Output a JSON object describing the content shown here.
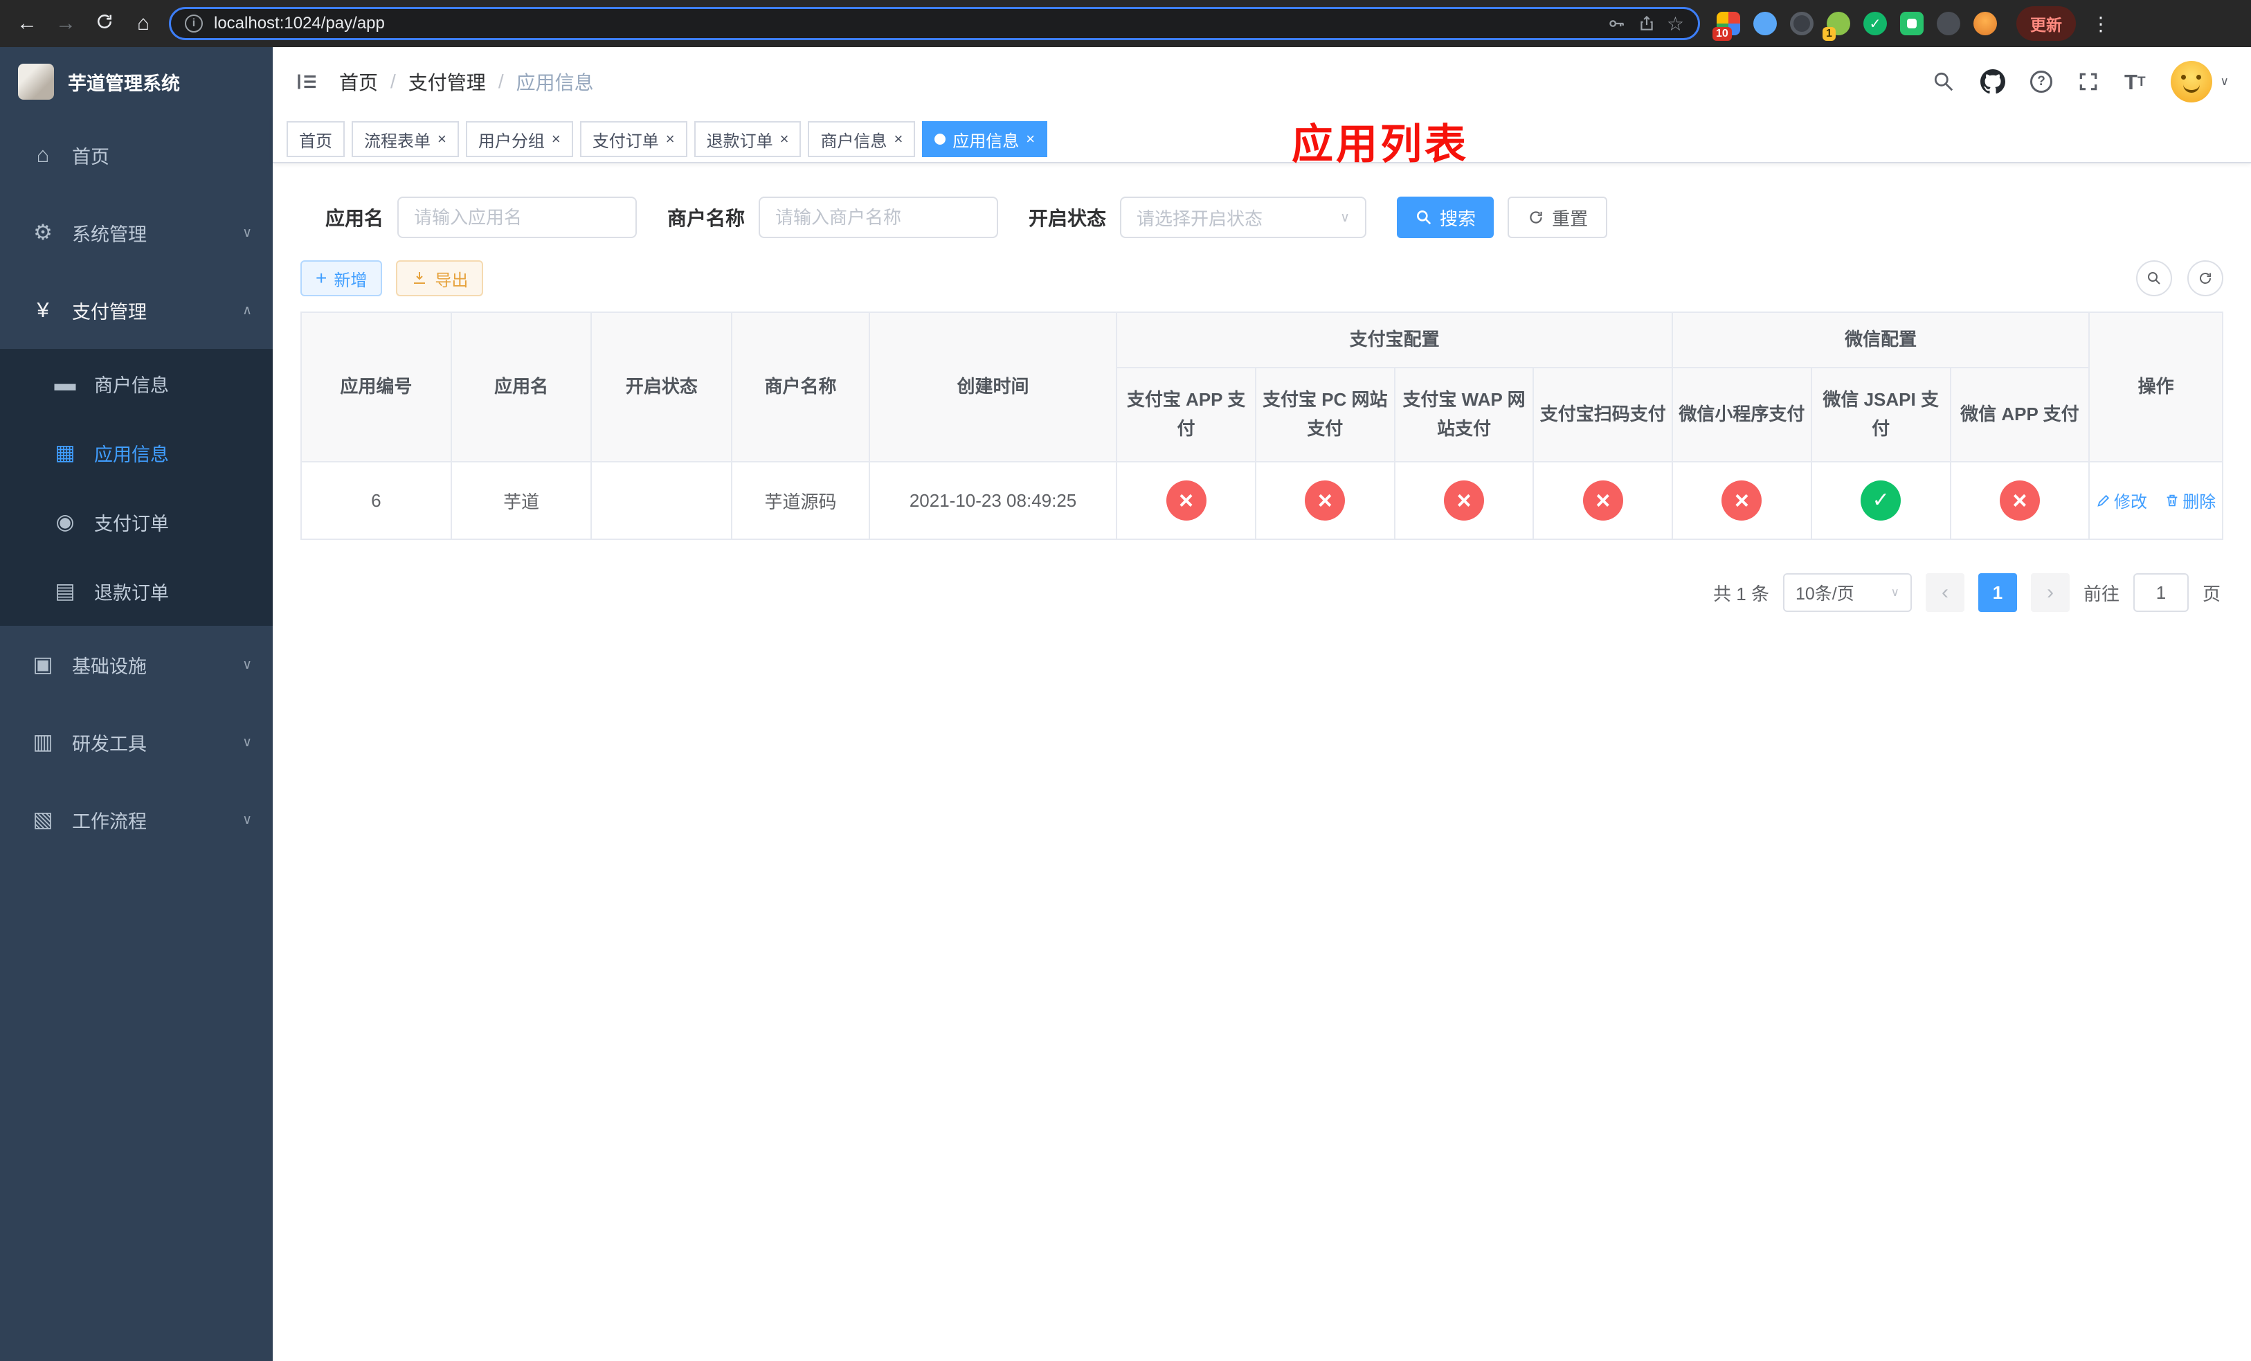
{
  "browser": {
    "url": "localhost:1024/pay/app",
    "update_label": "更新",
    "ext_badge_a": "10",
    "ext_badge_b": "1"
  },
  "sidebar": {
    "title": "芋道管理系统",
    "items": [
      {
        "label": "首页"
      },
      {
        "label": "系统管理"
      },
      {
        "label": "支付管理"
      },
      {
        "label": "商户信息"
      },
      {
        "label": "应用信息"
      },
      {
        "label": "支付订单"
      },
      {
        "label": "退款订单"
      },
      {
        "label": "基础设施"
      },
      {
        "label": "研发工具"
      },
      {
        "label": "工作流程"
      }
    ]
  },
  "navbar": {
    "breadcrumb": [
      "首页",
      "支付管理",
      "应用信息"
    ],
    "annotation": "应用列表"
  },
  "tabs": [
    {
      "label": "首页"
    },
    {
      "label": "流程表单"
    },
    {
      "label": "用户分组"
    },
    {
      "label": "支付订单"
    },
    {
      "label": "退款订单"
    },
    {
      "label": "商户信息"
    },
    {
      "label": "应用信息"
    }
  ],
  "filter": {
    "app_name_label": "应用名",
    "app_name_placeholder": "请输入应用名",
    "merchant_label": "商户名称",
    "merchant_placeholder": "请输入商户名称",
    "status_label": "开启状态",
    "status_placeholder": "请选择开启状态",
    "search_label": "搜索",
    "reset_label": "重置"
  },
  "toolbar": {
    "add_label": "新增",
    "export_label": "导出"
  },
  "table": {
    "headers": {
      "app_id": "应用编号",
      "app_name": "应用名",
      "status": "开启状态",
      "merchant": "商户名称",
      "created": "创建时间",
      "alipay_group": "支付宝配置",
      "wechat_group": "微信配置",
      "alipay_app": "支付宝 APP 支付",
      "alipay_pc": "支付宝 PC 网站支付",
      "alipay_wap": "支付宝 WAP 网站支付",
      "alipay_qr": "支付宝扫码支付",
      "wx_mini": "微信小程序支付",
      "wx_jsapi": "微信 JSAPI 支付",
      "wx_app": "微信 APP 支付",
      "actions": "操作"
    },
    "row": {
      "app_id": "6",
      "app_name": "芋道",
      "toggle_state": "on",
      "merchant": "芋道源码",
      "created": "2021-10-23 08:49:25",
      "statuses": {
        "alipay_app": "fail",
        "alipay_pc": "fail",
        "alipay_wap": "fail",
        "alipay_qr": "fail",
        "wx_mini": "fail",
        "wx_jsapi": "success",
        "wx_app": "fail"
      },
      "edit_label": "修改",
      "delete_label": "删除"
    }
  },
  "pagination": {
    "total": "共 1 条",
    "page_size": "10条/页",
    "current_page": "1",
    "goto_label": "前往",
    "goto_value": "1",
    "page_unit": "页"
  },
  "colors": {
    "accent_blue": "#409eff",
    "success_green": "#0fc269",
    "danger_red": "#f7605f",
    "sidebar_bg": "#304156",
    "submenu_bg": "#1f2d3d",
    "annotation_red": "#f6120b",
    "warning_orange": "#e6a23c"
  }
}
